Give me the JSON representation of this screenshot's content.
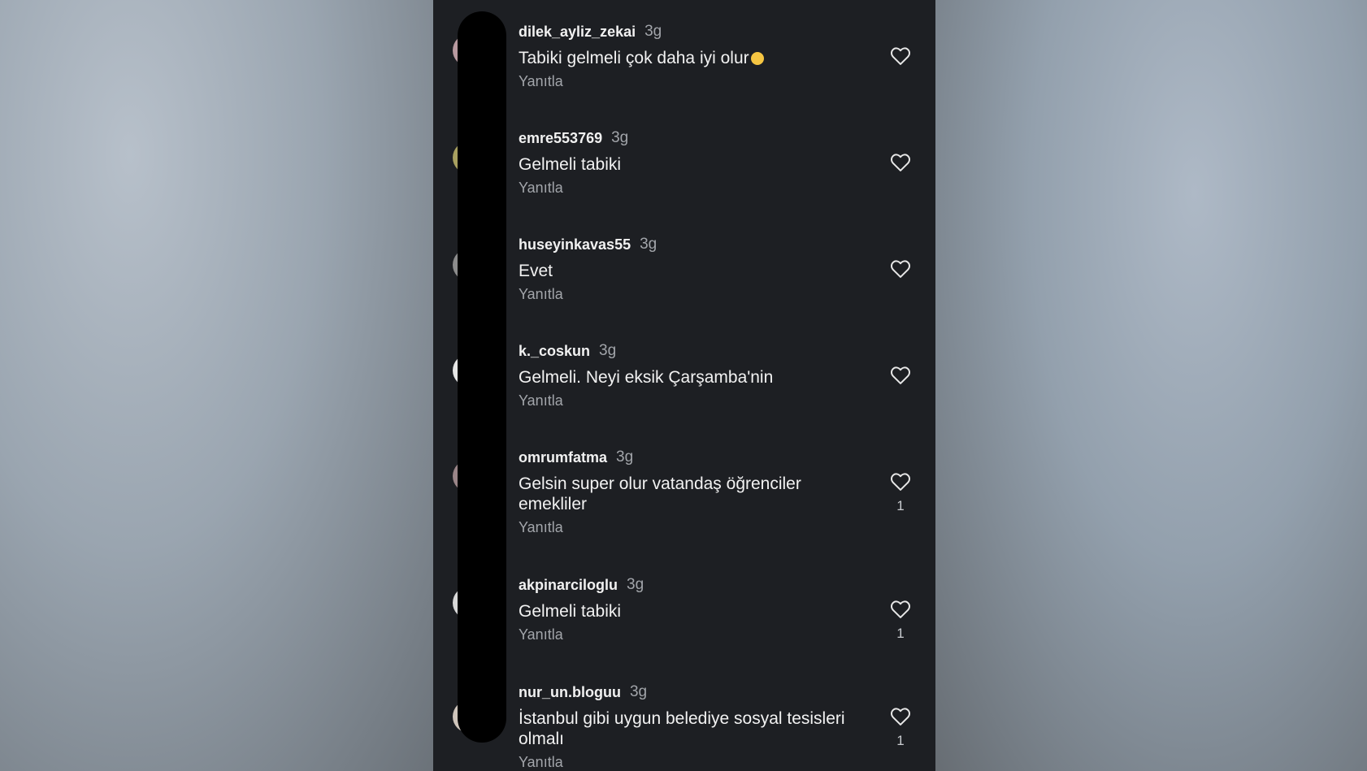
{
  "comments": [
    {
      "username": "dilek_ayliz_zekai",
      "time": "3g",
      "text": "Tabiki gelmeli çok daha iyi olur",
      "emoji": "clapping-hands-emoji",
      "reply": "Yanıtla",
      "likes": ""
    },
    {
      "username": "emre553769",
      "time": "3g",
      "text": "Gelmeli tabiki",
      "reply": "Yanıtla",
      "likes": ""
    },
    {
      "username": "huseyinkavas55",
      "time": "3g",
      "text": "Evet",
      "reply": "Yanıtla",
      "likes": ""
    },
    {
      "username": "k._coskun",
      "time": "3g",
      "text": "Gelmeli. Neyi eksik Çarşamba'nin",
      "reply": "Yanıtla",
      "likes": ""
    },
    {
      "username": "omrumfatma",
      "time": "3g",
      "text": "Gelsin super olur vatandaş öğrenciler emekliler",
      "reply": "Yanıtla",
      "likes": "1"
    },
    {
      "username": "akpinarciloglu",
      "time": "3g",
      "text": "Gelmeli tabiki",
      "reply": "Yanıtla",
      "likes": "1"
    },
    {
      "username": "nur_un.bloguu",
      "time": "3g",
      "text": "İstanbul gibi  uygun belediye sosyal tesisleri olmalı",
      "reply": "Yanıtla",
      "likes": "1"
    }
  ],
  "colors": {
    "panel_background": "#1d1f23",
    "primary_text": "#f2f2f2",
    "secondary_text": "#a2a5aa"
  }
}
